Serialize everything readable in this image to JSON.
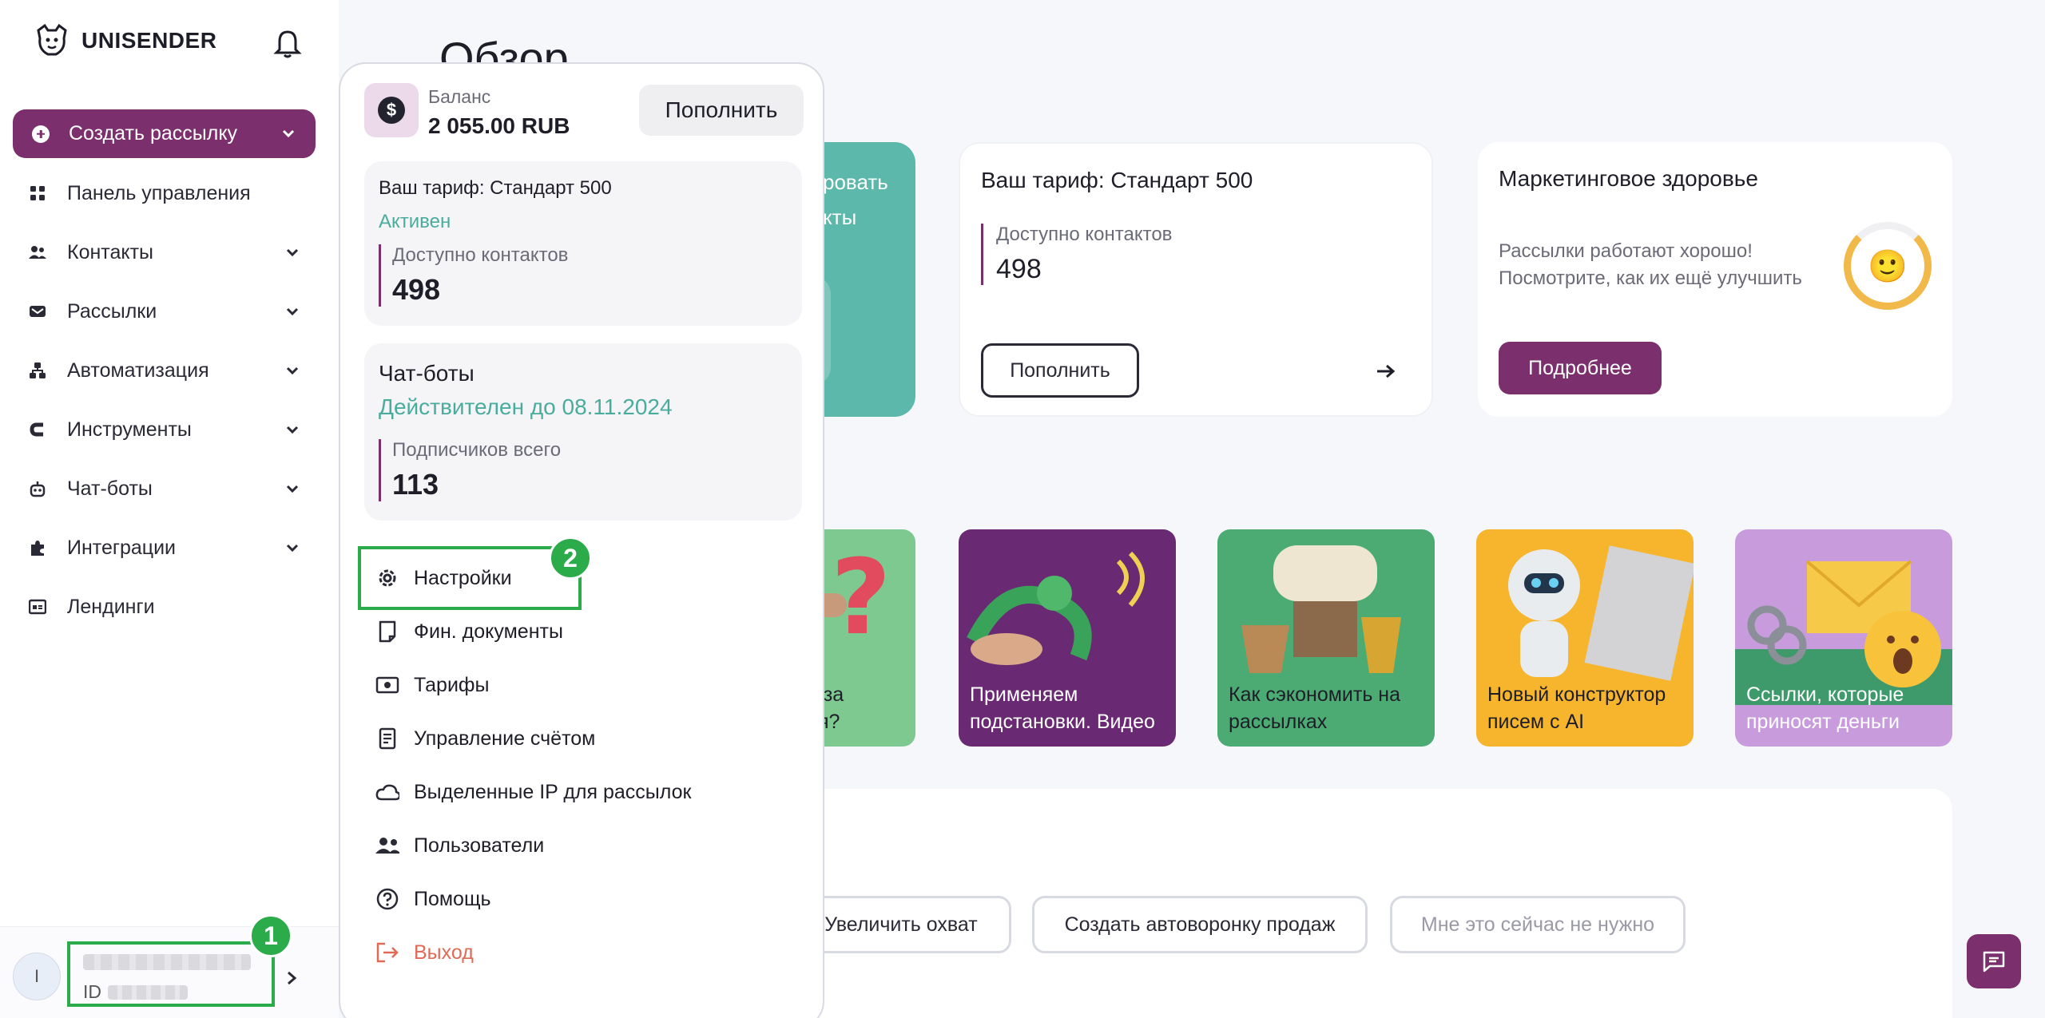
{
  "app": {
    "logo_text": "UNISENDER"
  },
  "sidebar": {
    "create_label": "Создать рассылку",
    "items": [
      {
        "label": "Панель управления"
      },
      {
        "label": "Контакты"
      },
      {
        "label": "Рассылки"
      },
      {
        "label": "Автоматизация"
      },
      {
        "label": "Инструменты"
      },
      {
        "label": "Чат-боты"
      },
      {
        "label": "Интеграции"
      },
      {
        "label": "Лендинги"
      }
    ],
    "user": {
      "avatar_letter": "I",
      "id_prefix": "ID"
    }
  },
  "badges": [
    "1",
    "2"
  ],
  "account_panel": {
    "balance_label": "Баланс",
    "balance_value": "2 055.00 RUB",
    "topup_label": "Пополнить",
    "tariff": {
      "title": "Ваш тариф: Стандарт 500",
      "status": "Активен",
      "contacts_label": "Доступно контактов",
      "contacts_value": "498"
    },
    "chatbots": {
      "title": "Чат-боты",
      "valid_until": "Действителен до 08.11.2024",
      "subscribers_label": "Подписчиков всего",
      "subscribers_value": "113"
    },
    "menu": [
      {
        "label": "Настройки"
      },
      {
        "label": "Фин. документы"
      },
      {
        "label": "Тарифы"
      },
      {
        "label": "Управление счётом"
      },
      {
        "label": "Выделенные IP для рассылок"
      },
      {
        "label": "Пользователи"
      },
      {
        "label": "Помощь"
      },
      {
        "label": "Выход"
      }
    ]
  },
  "main": {
    "page_title": "Обзор",
    "teal_card_text": [
      "ровать",
      "кты"
    ],
    "tariff_card": {
      "title": "Ваш тариф: Стандарт 500",
      "contacts_label": "Доступно контактов",
      "contacts_value": "498",
      "topup_label": "Пополнить"
    },
    "health_card": {
      "title": "Маркетинговое здоровье",
      "desc_line1": "Рассылки работают хорошо!",
      "desc_line2": "Посмотрите, как их ещё улучшить",
      "more_label": "Подробнее"
    },
    "articles": [
      {
        "line1": "о за",
        "line2": "ия?"
      },
      {
        "line1": "Применяем",
        "line2": "подстановки. Видео"
      },
      {
        "line1": "Как сэкономить на",
        "line2": "рассылках"
      },
      {
        "line1": "Новый конструктор",
        "line2": "писем с AI"
      },
      {
        "line1": "Ссылки, которые",
        "line2": "приносят деньги"
      }
    ],
    "chips": [
      "Увеличить охват",
      "Создать автоворонку продаж",
      "Мне это сейчас не нужно"
    ]
  },
  "colors": {
    "brand": "#7b2f6d",
    "accent_teal": "#4aac9c",
    "highlight_green": "#2cab4a",
    "logout": "#e06a55"
  }
}
